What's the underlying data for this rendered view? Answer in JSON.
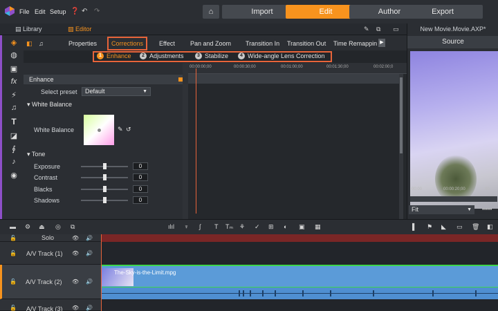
{
  "app": {
    "menu": [
      "File",
      "Edit",
      "Setup"
    ],
    "modes": [
      {
        "label": "Import",
        "active": false
      },
      {
        "label": "Edit",
        "active": true
      },
      {
        "label": "Author",
        "active": false
      },
      {
        "label": "Export",
        "active": false
      }
    ],
    "accent": "#f7931e",
    "highlight": "#e8643a"
  },
  "row2": {
    "library": "Library",
    "editor": "Editor"
  },
  "right_panel": {
    "title": "New Movie.Movie.AXP*",
    "source_tab": "Source",
    "times": [
      "00:00",
      "00:00:20;00",
      "00:"
    ],
    "zoom": "Fit"
  },
  "property_tabs": [
    "Properties",
    "Corrections",
    "Effect",
    "Pan and Zoom",
    "Transition In",
    "Transition Out",
    "Time Remappin"
  ],
  "sub_tabs": [
    {
      "num": "1",
      "label": "Enhance"
    },
    {
      "num": "2",
      "label": "Adjustments"
    },
    {
      "num": "3",
      "label": "Stabilize"
    },
    {
      "num": "4",
      "label": "Wide-angle Lens Correction"
    }
  ],
  "enhance": {
    "header": "Enhance",
    "preset_label": "Select preset",
    "preset_value": "Default",
    "white_balance_section": "White Balance",
    "white_balance_label": "White Balance",
    "tone_section": "Tone",
    "sliders": [
      {
        "label": "Exposure",
        "value": "0"
      },
      {
        "label": "Contrast",
        "value": "0"
      },
      {
        "label": "Blacks",
        "value": "0"
      },
      {
        "label": "Shadows",
        "value": "0"
      }
    ]
  },
  "ruler_ticks": [
    "00:00:00;00",
    "00:00:30;00",
    "00:01:00;00",
    "00:01:30;00",
    "00:02:00;0"
  ],
  "tracks": [
    {
      "name": "Solo"
    },
    {
      "name": "A/V Track (1)"
    },
    {
      "name": "A/V Track (2)",
      "clip": "The-Sky-is-the-Limit.mpg"
    },
    {
      "name": "A/V Track (3)"
    }
  ]
}
